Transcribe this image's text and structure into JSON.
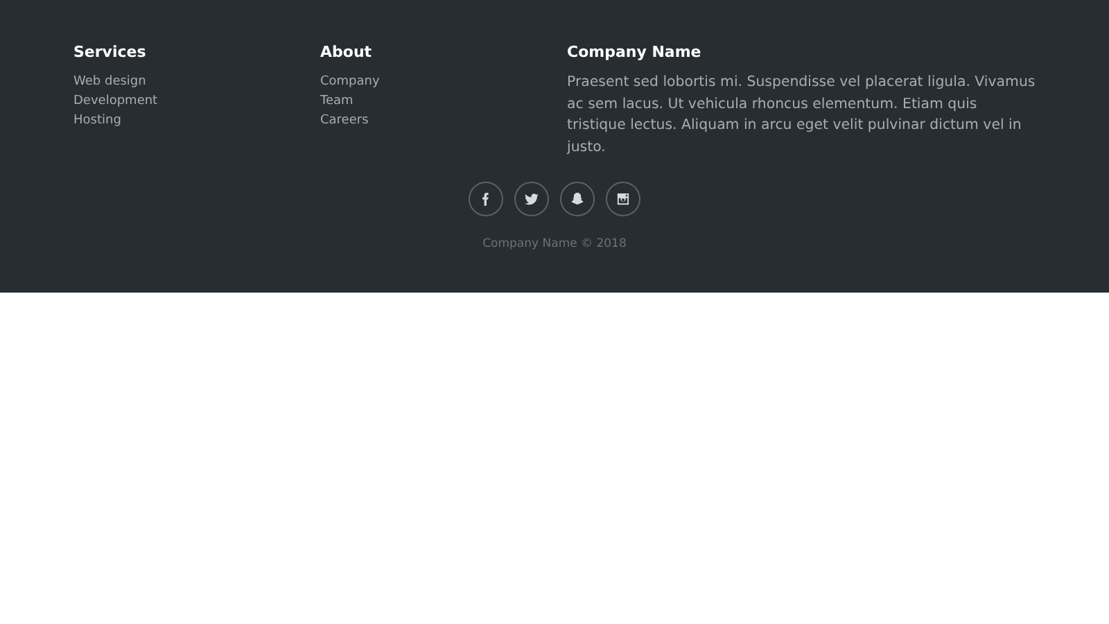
{
  "footer": {
    "columns": [
      {
        "heading": "Services",
        "links": [
          "Web design",
          "Development",
          "Hosting"
        ]
      },
      {
        "heading": "About",
        "links": [
          "Company",
          "Team",
          "Careers"
        ]
      }
    ],
    "about": {
      "heading": "Company Name",
      "text": "Praesent sed lobortis mi. Suspendisse vel placerat ligula. Vivamus ac sem lacus. Ut vehicula rhoncus elementum. Etiam quis tristique lectus. Aliquam in arcu eget velit pulvinar dictum vel in justo."
    },
    "social": [
      {
        "kind": "facebook"
      },
      {
        "kind": "twitter"
      },
      {
        "kind": "ghost"
      },
      {
        "kind": "camera"
      }
    ],
    "copyright": "Company Name © 2018"
  }
}
